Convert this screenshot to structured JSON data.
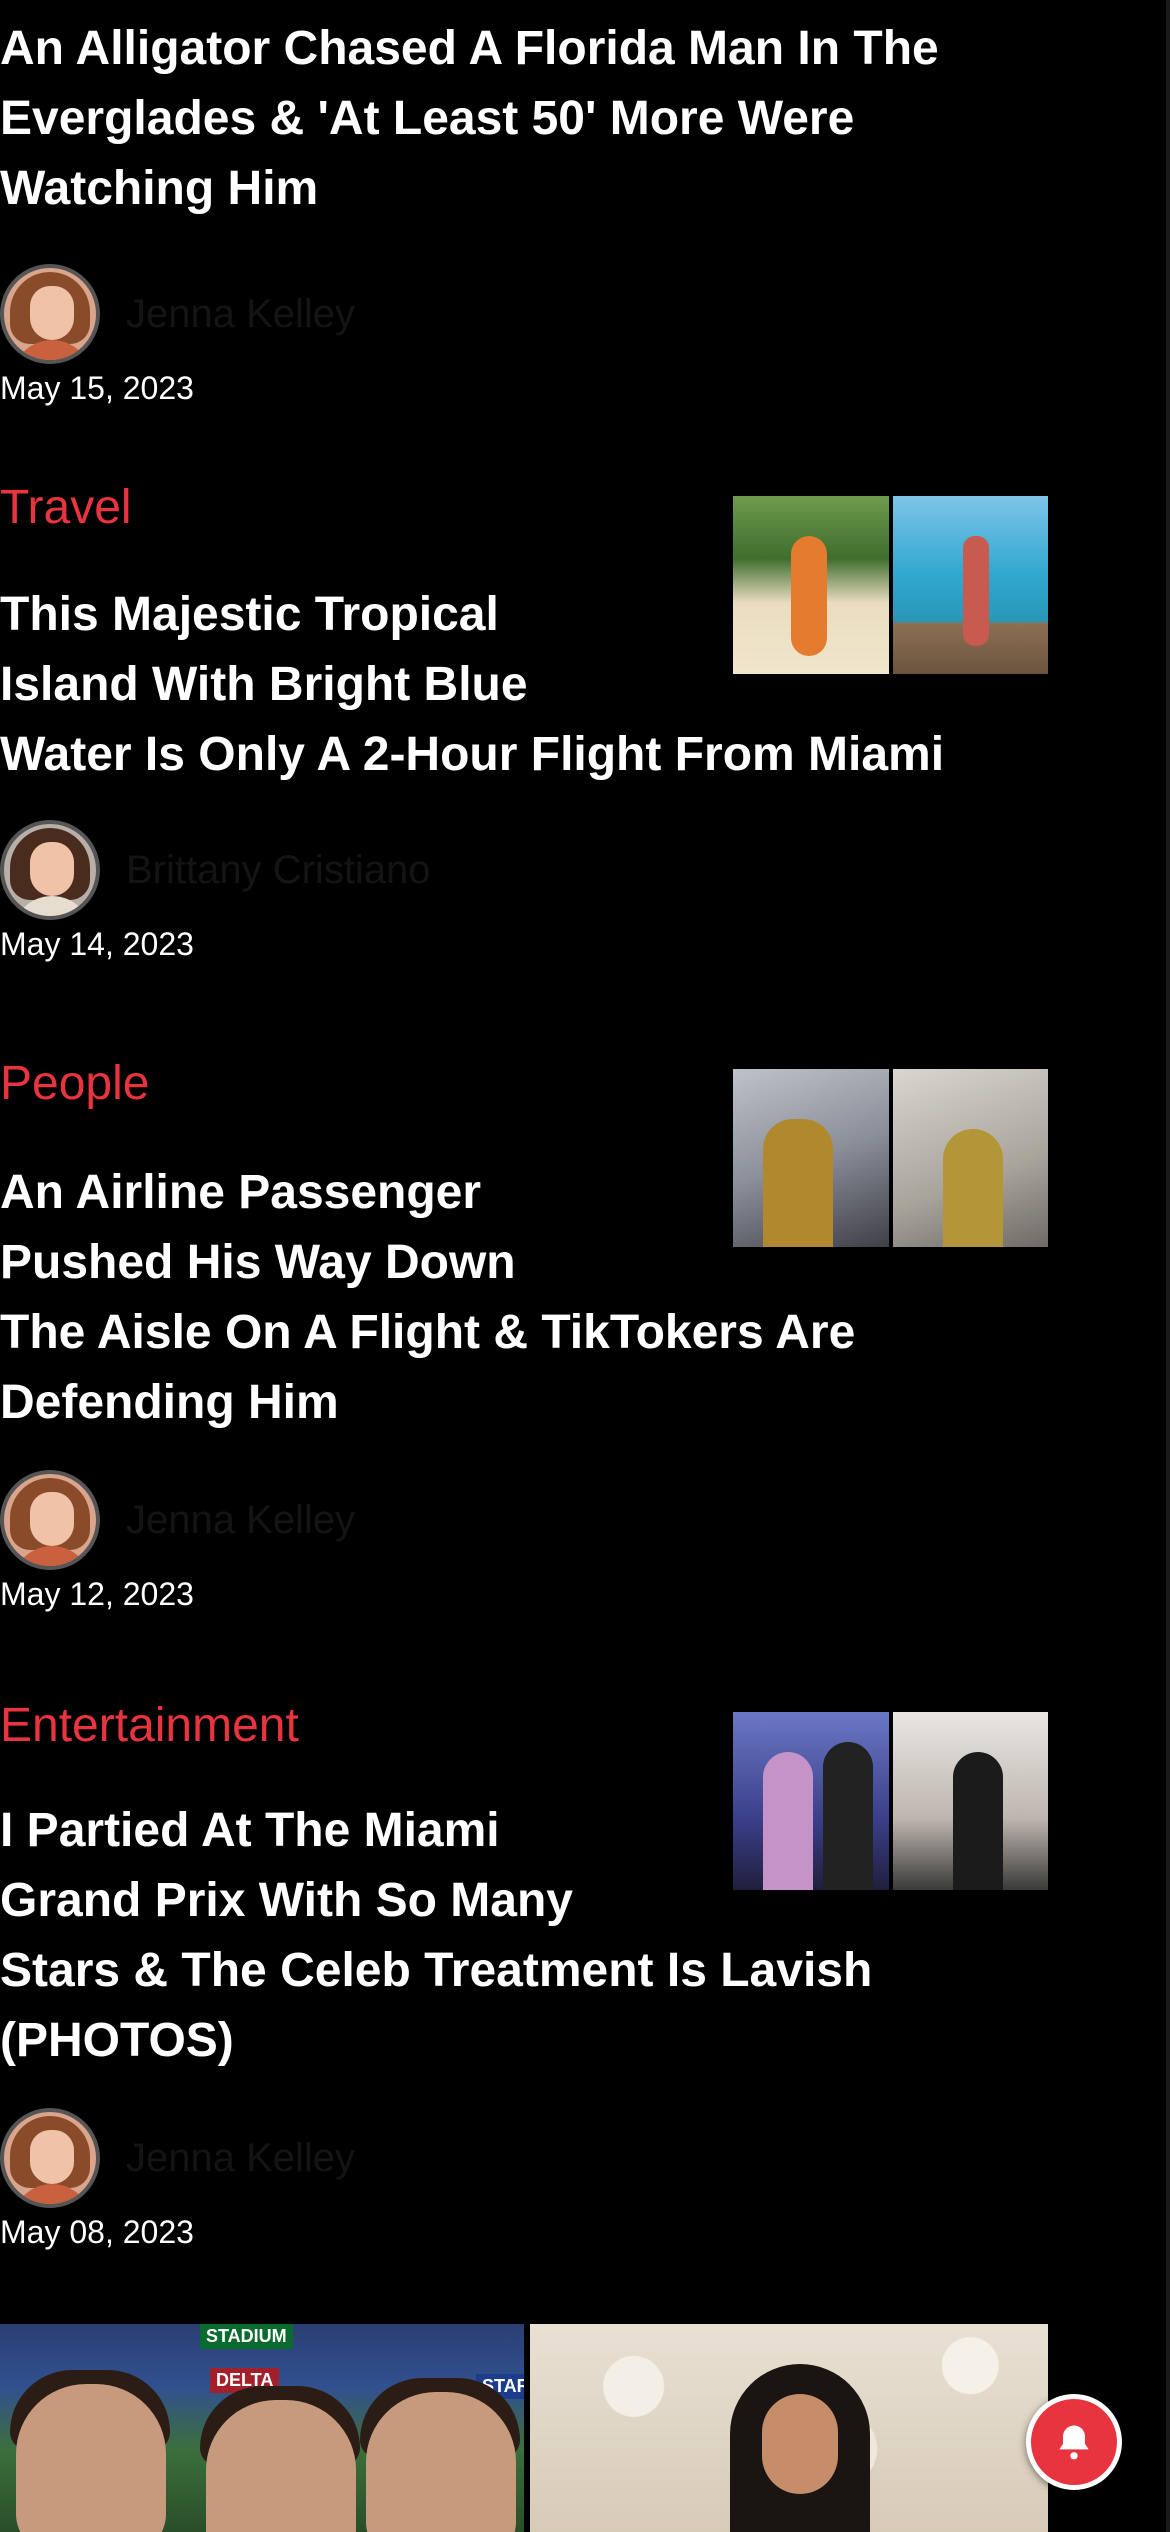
{
  "articles": [
    {
      "headline_lines": [
        "An Alligator Chased A Florida Man In The",
        "Everglades & 'At Least 50' More Were",
        "Watching Him"
      ],
      "author": "Jenna Kelley",
      "date": "May 15, 2023"
    },
    {
      "category": "Travel",
      "headline_lines": [
        "This Majestic Tropical",
        "Island With Bright Blue",
        "Water Is Only A 2-Hour Flight From Miami"
      ],
      "author": "Brittany Cristiano",
      "date": "May 14, 2023"
    },
    {
      "category": "People",
      "headline_lines": [
        "An Airline Passenger",
        "Pushed His Way Down",
        "The Aisle On A Flight & TikTokers Are",
        "Defending Him"
      ],
      "author": "Jenna Kelley",
      "date": "May 12, 2023"
    },
    {
      "category": "Entertainment",
      "headline_lines": [
        "I Partied At The Miami",
        "Grand Prix With So Many",
        "Stars & The Celeb Treatment Is Lavish",
        "(PHOTOS)"
      ],
      "author": "Jenna Kelley",
      "date": "May 08, 2023"
    }
  ],
  "bottom": {
    "stadium_signs": [
      "STADIUM",
      "DELTA",
      "STAR"
    ]
  },
  "notification_button": {
    "icon": "bell-icon"
  },
  "colors": {
    "accent": "#e8343f",
    "background": "#000000",
    "text": "#ffffff",
    "author": "#141414"
  }
}
